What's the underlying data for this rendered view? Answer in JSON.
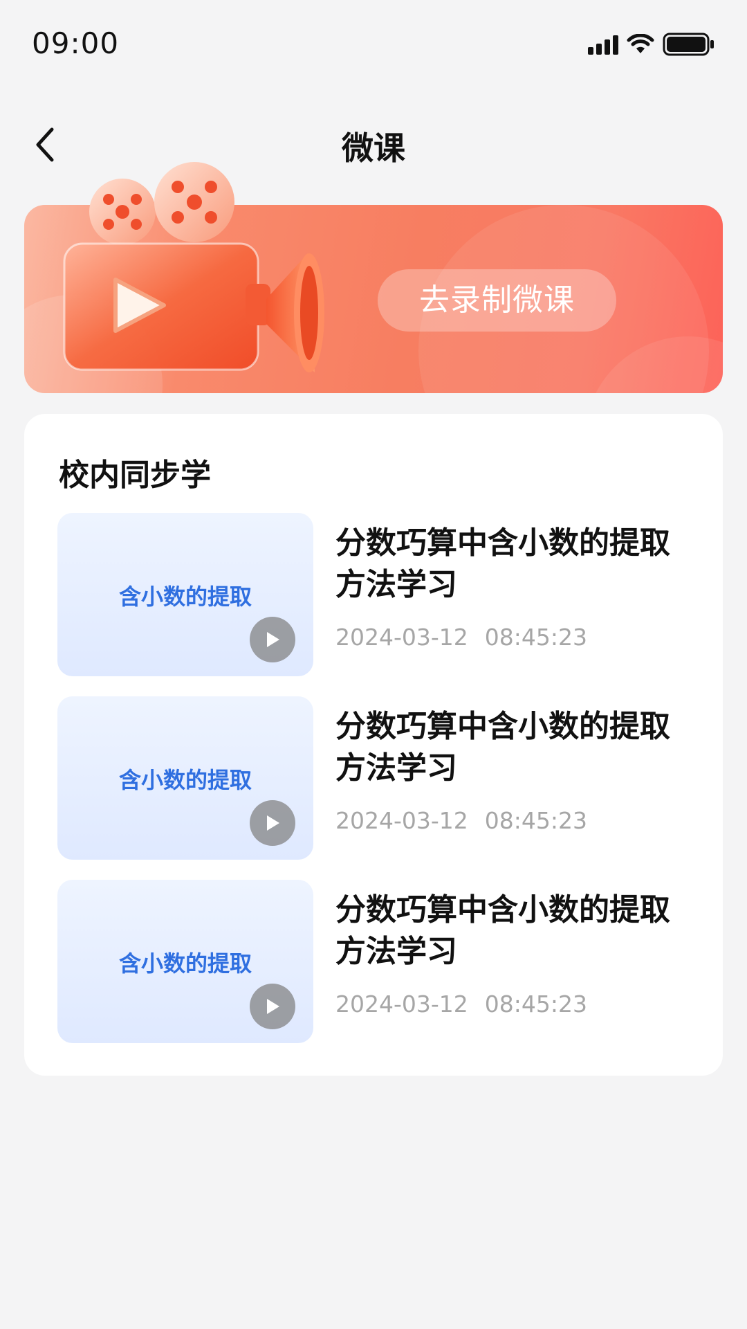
{
  "status_bar": {
    "time": "09:00"
  },
  "nav": {
    "title": "微课"
  },
  "banner": {
    "button_label": "去录制微课"
  },
  "section": {
    "title": "校内同步学"
  },
  "items": [
    {
      "thumb_label": "含小数的提取",
      "title": "分数巧算中含小数的提取方法学习",
      "date": "2024-03-12",
      "time": "08:45:23"
    },
    {
      "thumb_label": "含小数的提取",
      "title": "分数巧算中含小数的提取方法学习",
      "date": "2024-03-12",
      "time": "08:45:23"
    },
    {
      "thumb_label": "含小数的提取",
      "title": "分数巧算中含小数的提取方法学习",
      "date": "2024-03-12",
      "time": "08:45:23"
    }
  ],
  "colors": {
    "accent_blue": "#2f6fe0",
    "banner_start": "#fbb8a2",
    "banner_end": "#fd6258",
    "meta_gray": "#a6a6a6"
  },
  "icons": [
    "back-icon",
    "signal-icon",
    "wifi-icon",
    "battery-icon",
    "camera-illustration",
    "play-icon"
  ]
}
